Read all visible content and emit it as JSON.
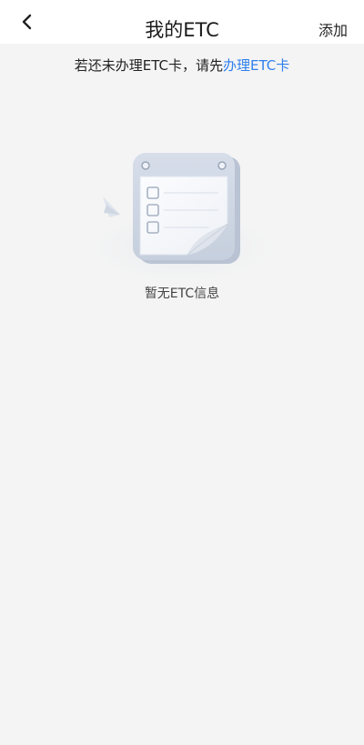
{
  "header": {
    "title": "我的ETC",
    "add_label": "添加",
    "back_icon": "chevron-left-icon"
  },
  "notice": {
    "prefix": "若还未办理ETC卡，请先",
    "link_text": "办理ETC卡",
    "link_color": "#2f80ed"
  },
  "empty_state": {
    "message": "暂无ETC信息",
    "illustration": "empty-document-illustration"
  }
}
